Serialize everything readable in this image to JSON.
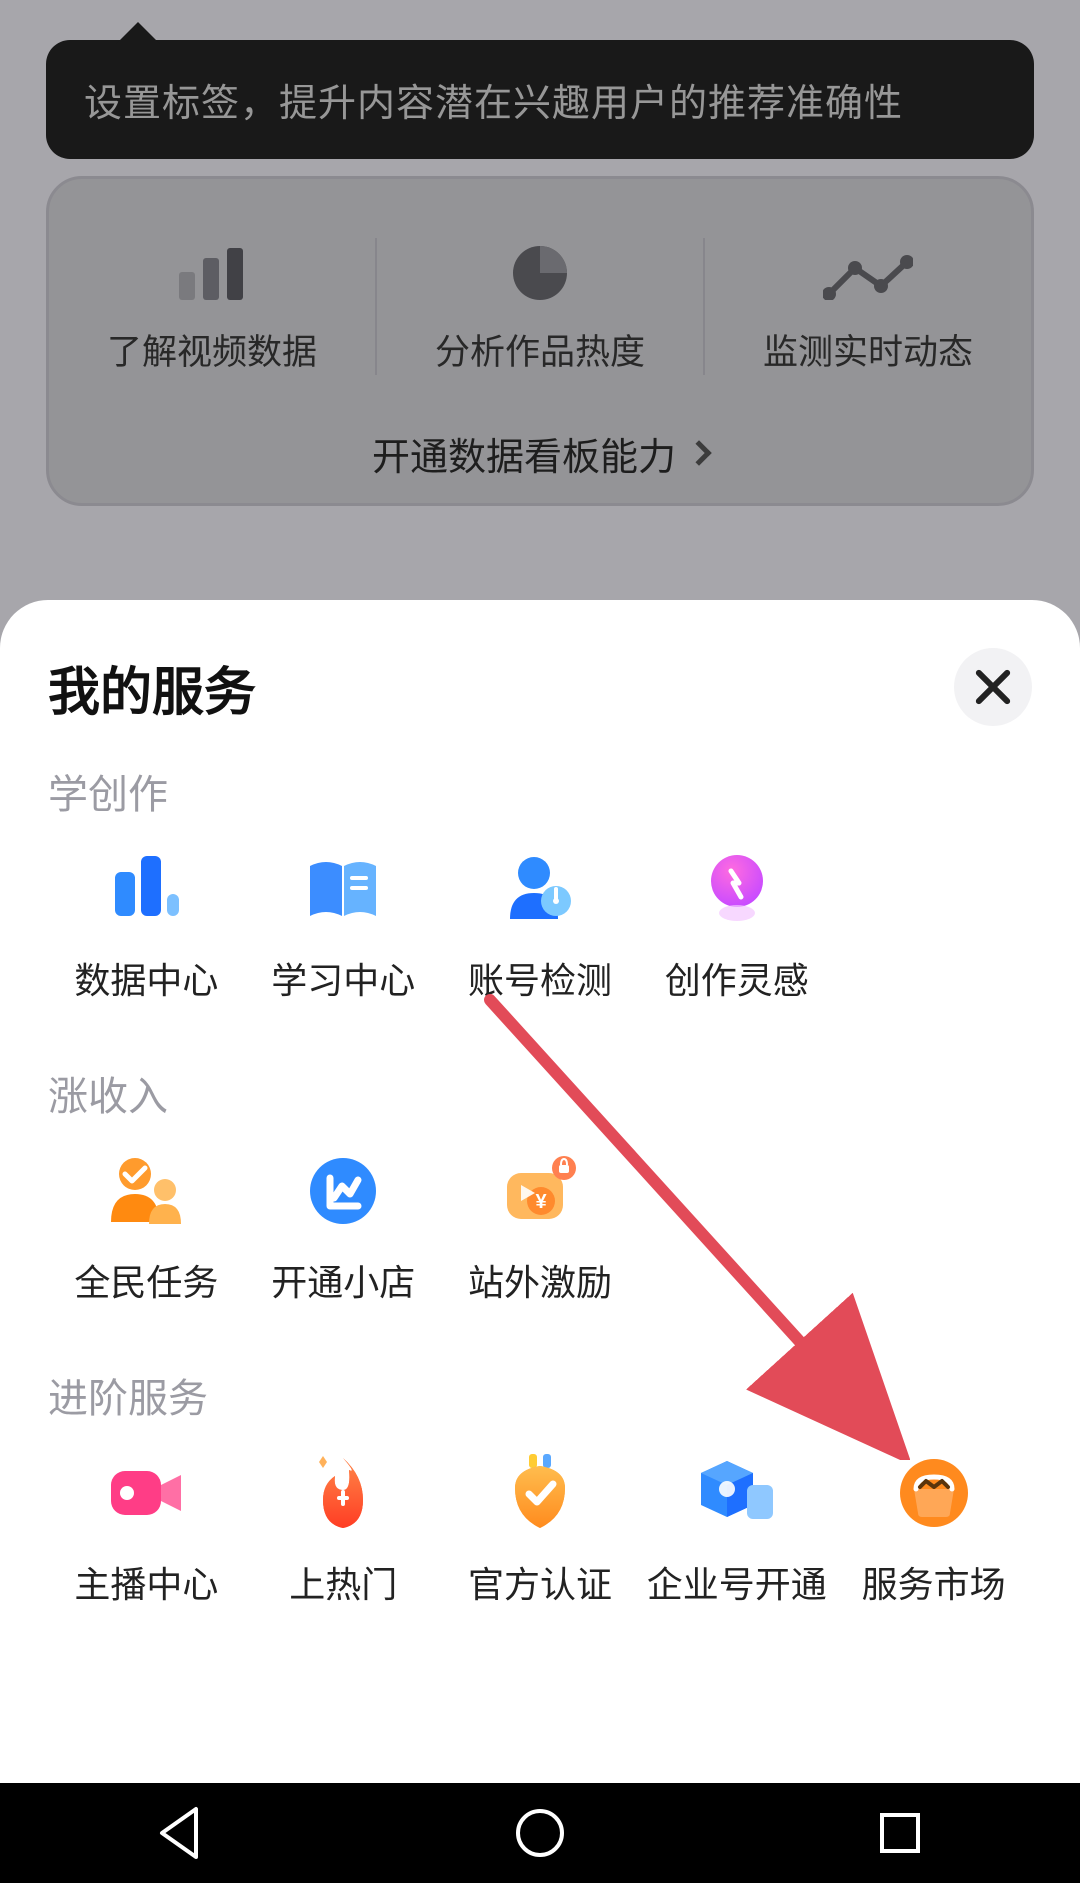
{
  "tooltip_text": "设置标签，提升内容潜在兴趣用户的推荐准确性",
  "databoard": {
    "items": [
      {
        "label": "了解视频数据"
      },
      {
        "label": "分析作品热度"
      },
      {
        "label": "监测实时动态"
      }
    ],
    "cta_label": "开通数据看板能力"
  },
  "sheet": {
    "title": "我的服务",
    "sections": [
      {
        "title": "学创作",
        "items": [
          {
            "label": "数据中心",
            "icon": "bars-blue-icon"
          },
          {
            "label": "学习中心",
            "icon": "book-blue-icon"
          },
          {
            "label": "账号检测",
            "icon": "person-gauge-icon"
          },
          {
            "label": "创作灵感",
            "icon": "bulb-pink-icon"
          }
        ]
      },
      {
        "title": "涨收入",
        "items": [
          {
            "label": "全民任务",
            "icon": "people-orange-icon"
          },
          {
            "label": "开通小店",
            "icon": "shop-blue-icon"
          },
          {
            "label": "站外激励",
            "icon": "bag-lock-icon"
          }
        ]
      },
      {
        "title": "进阶服务",
        "items": [
          {
            "label": "主播中心",
            "icon": "camera-pink-icon"
          },
          {
            "label": "上热门",
            "icon": "flame-orange-icon"
          },
          {
            "label": "官方认证",
            "icon": "shield-check-icon"
          },
          {
            "label": "企业号开通",
            "icon": "cube-blue-icon"
          },
          {
            "label": "服务市场",
            "icon": "store-orange-icon"
          }
        ]
      }
    ]
  },
  "colors": {
    "arrow": "#e24b58"
  }
}
